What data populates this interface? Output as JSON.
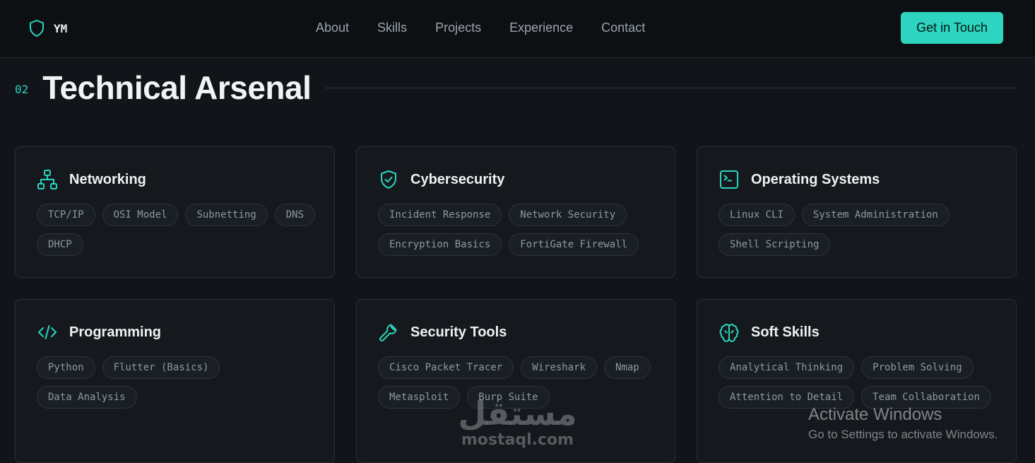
{
  "brand": {
    "text": "YM",
    "icon": "shield-icon"
  },
  "nav": {
    "links": [
      "About",
      "Skills",
      "Projects",
      "Experience",
      "Contact"
    ],
    "cta_label": "Get in Touch"
  },
  "section": {
    "number": "02",
    "title": "Technical Arsenal"
  },
  "colors": {
    "accent": "#2dd4bf",
    "background": "#111418",
    "card": "#15191d"
  },
  "cards": [
    {
      "title": "Networking",
      "icon": "network-icon",
      "tags": [
        "TCP/IP",
        "OSI Model",
        "Subnetting",
        "DNS",
        "DHCP"
      ]
    },
    {
      "title": "Cybersecurity",
      "icon": "shield-check-icon",
      "tags": [
        "Incident Response",
        "Network Security",
        "Encryption Basics",
        "FortiGate Firewall"
      ]
    },
    {
      "title": "Operating Systems",
      "icon": "terminal-icon",
      "tags": [
        "Linux CLI",
        "System Administration",
        "Shell Scripting"
      ]
    },
    {
      "title": "Programming",
      "icon": "code-icon",
      "tags": [
        "Python",
        "Flutter (Basics)",
        "Data Analysis"
      ]
    },
    {
      "title": "Security Tools",
      "icon": "wrench-icon",
      "tags": [
        "Cisco Packet Tracer",
        "Wireshark",
        "Nmap",
        "Metasploit",
        "Burp Suite"
      ]
    },
    {
      "title": "Soft Skills",
      "icon": "brain-icon",
      "tags": [
        "Analytical Thinking",
        "Problem Solving",
        "Attention to Detail",
        "Team Collaboration"
      ]
    }
  ],
  "watermark": {
    "arabic": "مستقل",
    "latin": "mostaql.com"
  },
  "os_overlay": {
    "title": "Activate Windows",
    "subtitle": "Go to Settings to activate Windows."
  }
}
